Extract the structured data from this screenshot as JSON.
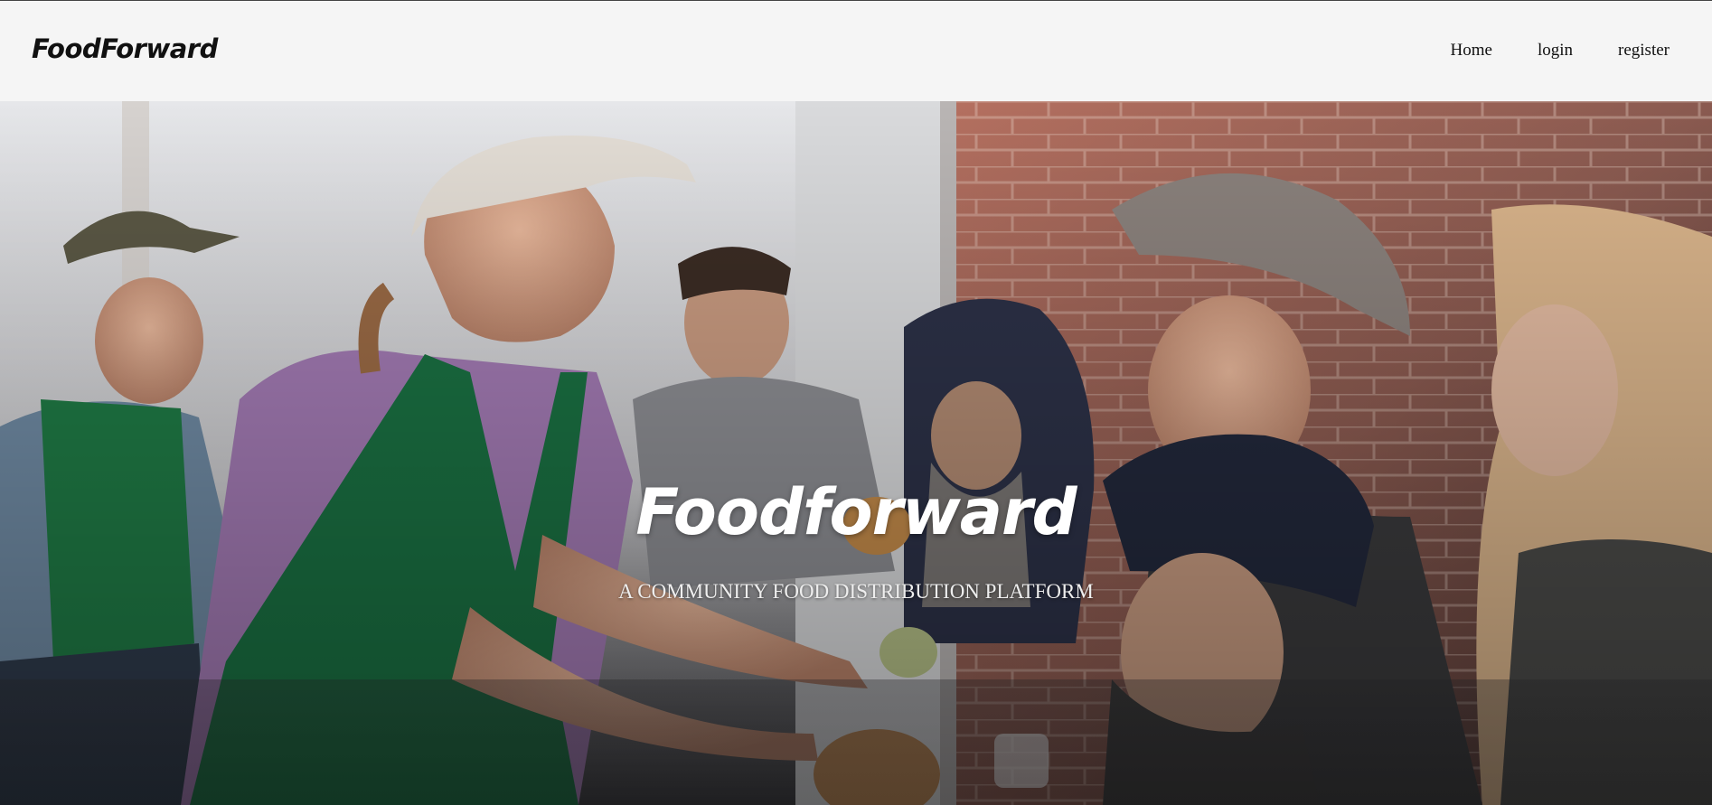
{
  "navbar": {
    "brand": "FoodForward",
    "links": [
      {
        "label": "Home"
      },
      {
        "label": "login"
      },
      {
        "label": "register"
      }
    ]
  },
  "hero": {
    "title": "Foodforward",
    "subtitle": "A COMMUNITY FOOD DISTRIBUTION PLATFORM",
    "photo": "volunteer-serving-food-photo"
  }
}
